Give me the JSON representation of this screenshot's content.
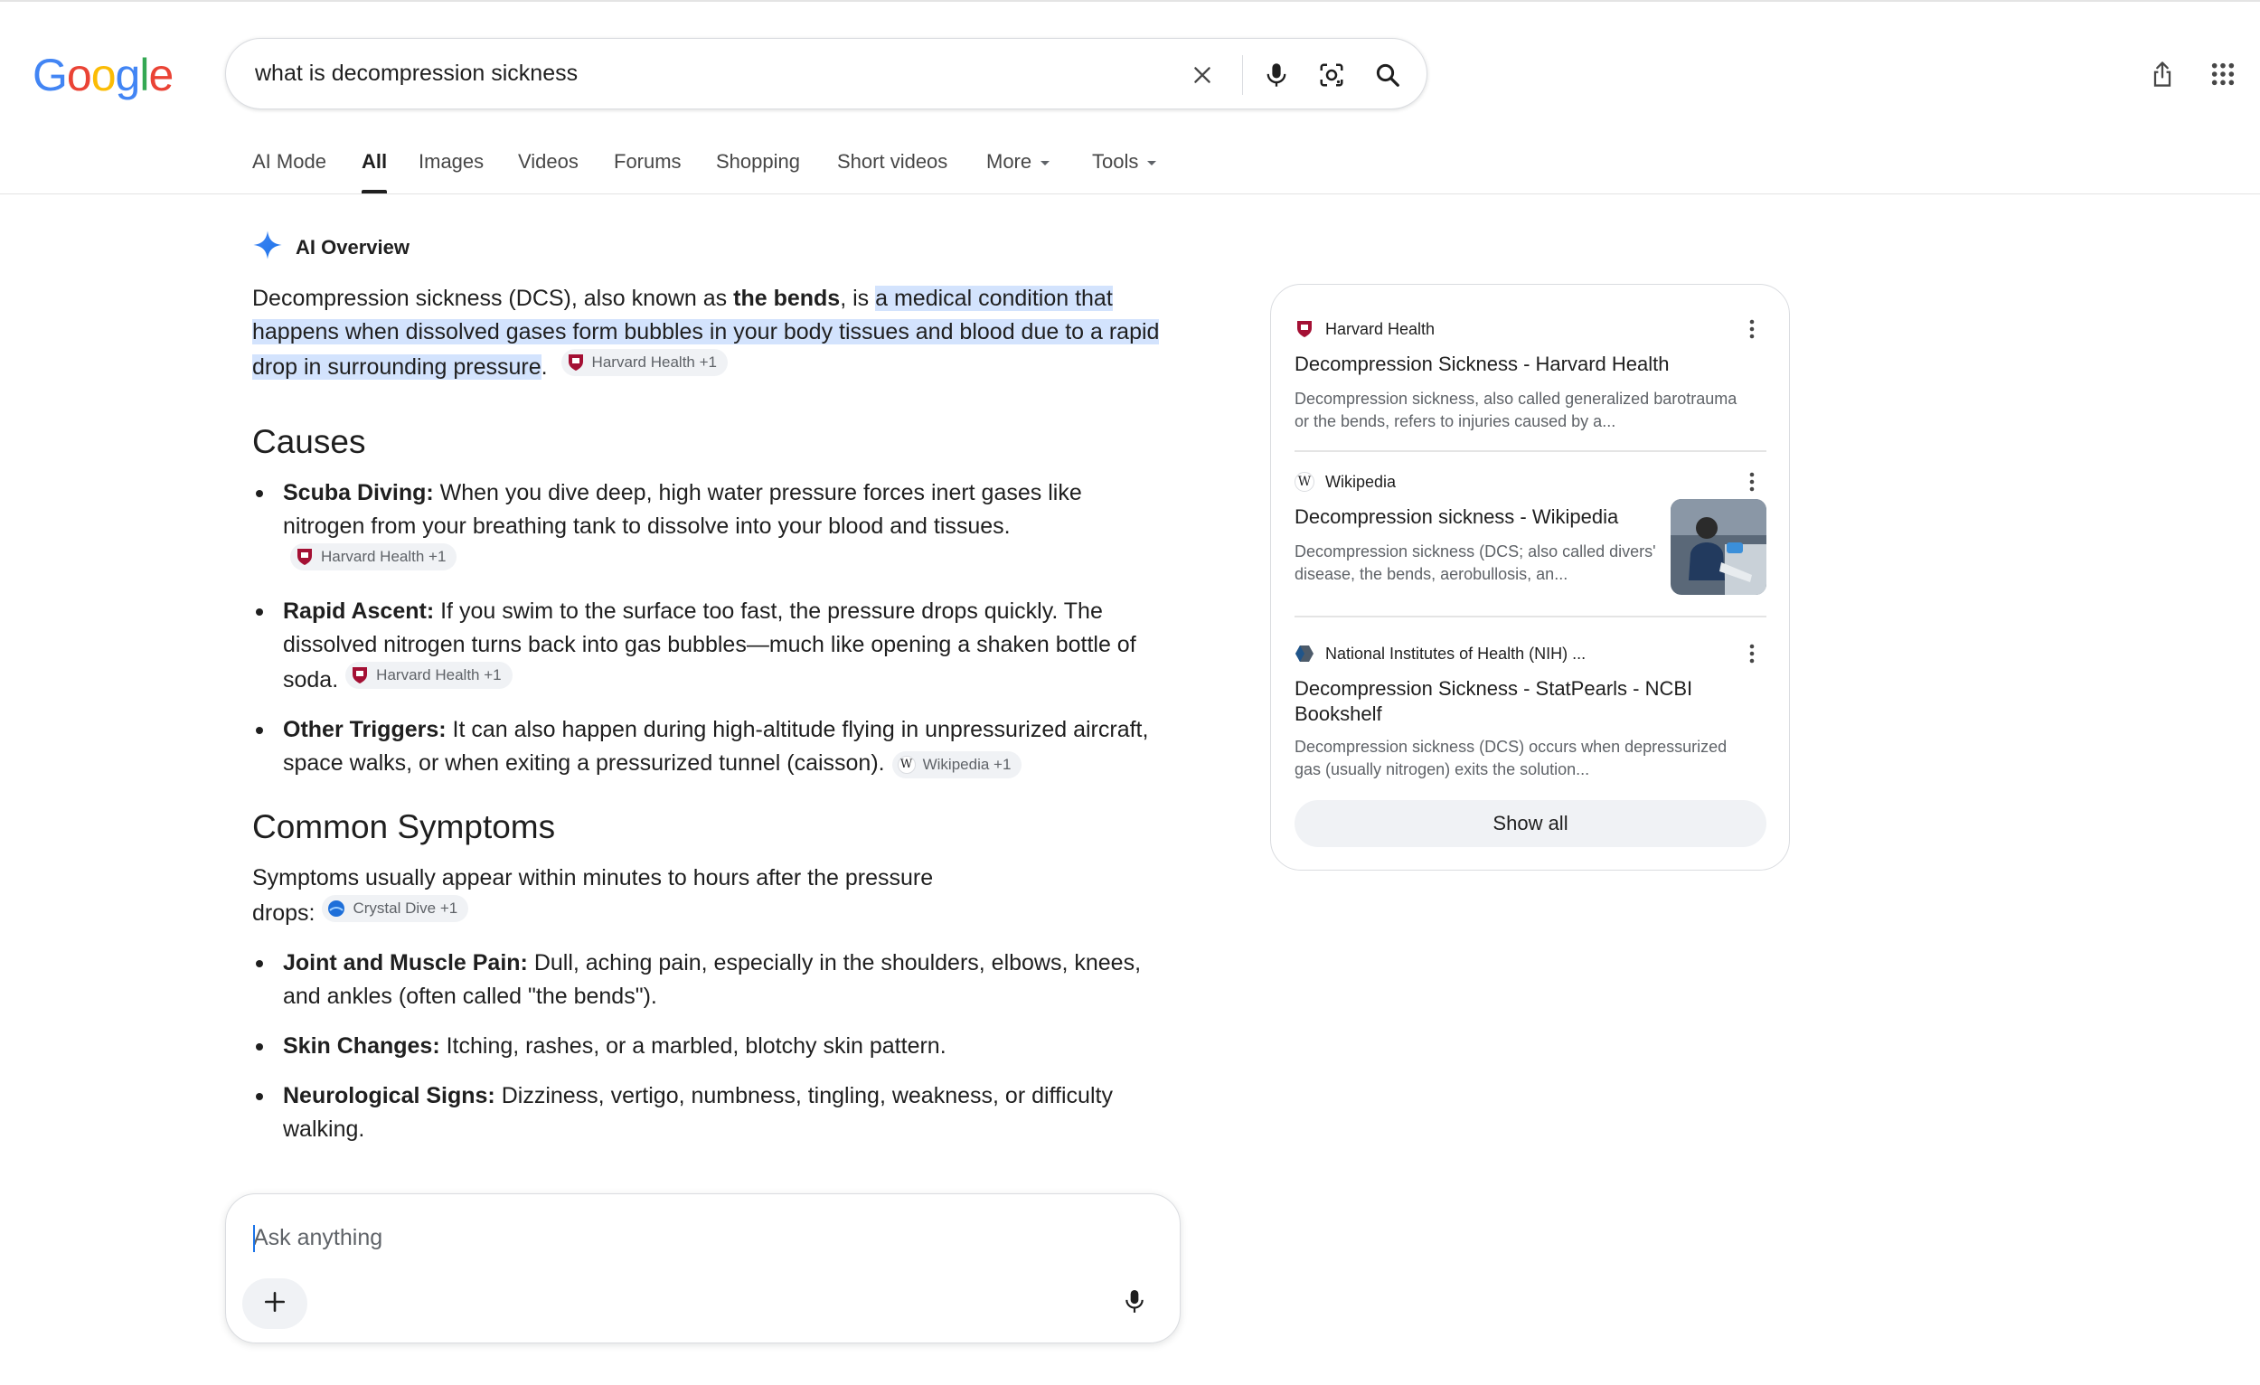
{
  "header": {
    "logo_letters": [
      "G",
      "o",
      "o",
      "g",
      "l",
      "e"
    ],
    "logo_colors": [
      "#4285F4",
      "#EA4335",
      "#FBBC05",
      "#4285F4",
      "#34A853",
      "#EA4335"
    ],
    "query": "what is decompression sickness"
  },
  "icons": {
    "clear": "close-icon",
    "voice": "microphone-icon",
    "lens": "camera-lens-icon",
    "search": "search-icon",
    "share": "share-icon",
    "apps": "apps-grid-icon"
  },
  "tabs": [
    {
      "label": "AI Mode",
      "active": false
    },
    {
      "label": "All",
      "active": true
    },
    {
      "label": "Images",
      "active": false
    },
    {
      "label": "Videos",
      "active": false
    },
    {
      "label": "Forums",
      "active": false
    },
    {
      "label": "Shopping",
      "active": false
    },
    {
      "label": "Short videos",
      "active": false
    },
    {
      "label": "More",
      "active": false,
      "dropdown": true
    },
    {
      "label": "Tools",
      "active": false,
      "dropdown": true
    }
  ],
  "overview": {
    "label": "AI Overview",
    "intro": {
      "prefix": "Decompression sickness (DCS), also known as ",
      "bold": "the bends",
      "middle": ", is ",
      "highlight": "a medical condition that happens when dissolved gases form bubbles in your body tissues and blood due to a rapid drop in surrounding pressure",
      "suffix": ".",
      "chip": "Harvard Health +1"
    },
    "causes": {
      "heading": "Causes",
      "items": [
        {
          "bold": "Scuba Diving:",
          "text": " When you dive deep, high water pressure forces inert gases like nitrogen from your breathing tank to dissolve into your blood and tissues.",
          "chip": "Harvard Health +1"
        },
        {
          "bold": "Rapid Ascent:",
          "text": " If you swim to the surface too fast, the pressure drops quickly. The dissolved nitrogen turns back into gas bubbles—much like opening a shaken bottle of soda.",
          "chip": "Harvard Health +1"
        },
        {
          "bold": "Other Triggers:",
          "text": " It can also happen during high-altitude flying in unpressurized aircraft, space walks, or when exiting a pressurized tunnel (caisson).",
          "chip": "Wikipedia +1"
        }
      ]
    },
    "symptoms": {
      "heading": "Common Symptoms",
      "intro": "Symptoms usually appear within minutes to hours after the pressure drops:",
      "chip": "Crystal Dive +1",
      "items": [
        {
          "bold": "Joint and Muscle Pain:",
          "text": " Dull, aching pain, especially in the shoulders, elbows, knees, and ankles (often called \"the bends\")."
        },
        {
          "bold": "Skin Changes:",
          "text": " Itching, rashes, or a marbled, blotchy skin pattern."
        },
        {
          "bold": "Neurological Signs:",
          "text": " Dizziness, vertigo, numbness, tingling, weakness, or difficulty walking."
        }
      ]
    }
  },
  "ask": {
    "placeholder": "Ask anything"
  },
  "sources": {
    "items": [
      {
        "site": "Harvard Health",
        "title": "Decompression Sickness - Harvard Health",
        "snippet": "Decompression sickness, also called generalized barotrauma or the bends, refers to injuries caused by a...",
        "favicon": "harvard-shield-icon"
      },
      {
        "site": "Wikipedia",
        "title": "Decompression sickness - Wikipedia",
        "snippet": "Decompression sickness (DCS; also called divers' disease, the bends, aerobullosis, an...",
        "favicon": "wikipedia-w-icon",
        "has_thumbnail": true
      },
      {
        "site": "National Institutes of Health (NIH) ...",
        "title": "Decompression Sickness - StatPearls - NCBI Bookshelf",
        "snippet": "Decompression sickness (DCS) occurs when depressurized gas (usually nitrogen) exits the solution...",
        "favicon": "nih-hexagon-icon"
      }
    ],
    "show_all": "Show all"
  }
}
